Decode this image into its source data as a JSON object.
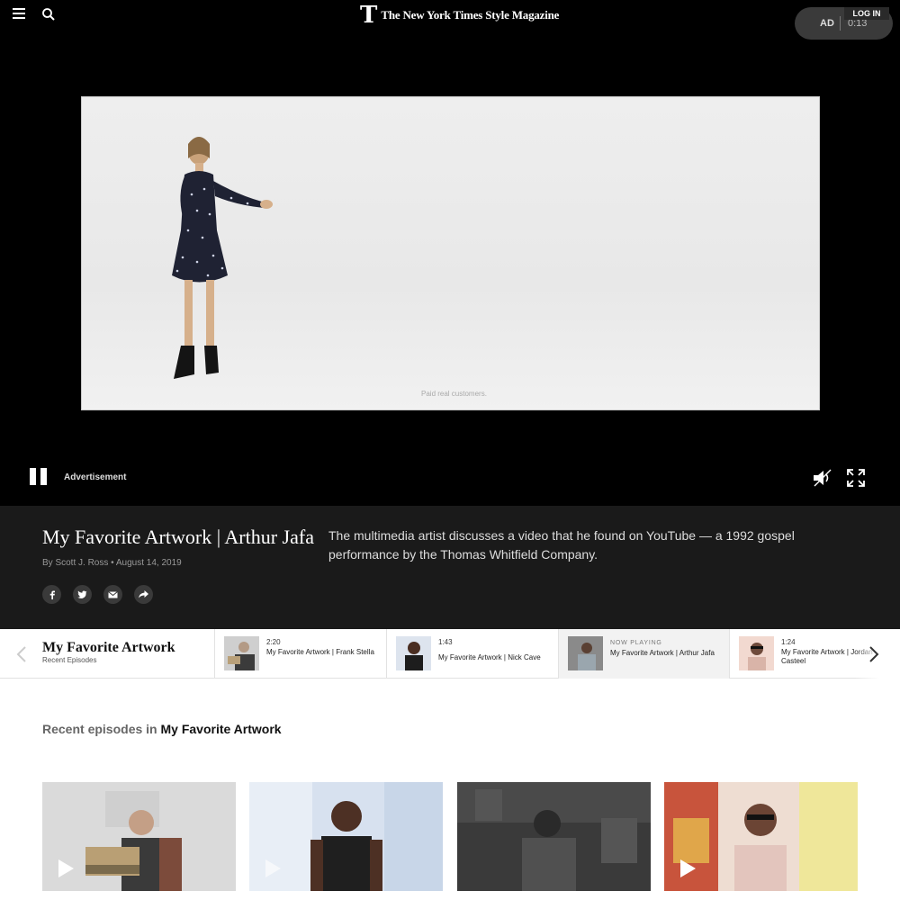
{
  "header": {
    "logo_mark": "T",
    "logo_text": "The New York Times Style Magazine",
    "ad_label": "AD",
    "ad_time": "0:13",
    "login_label": "LOG IN"
  },
  "video": {
    "disclaimer": "Paid real customers.",
    "advertisement_label": "Advertisement"
  },
  "info": {
    "title": "My Favorite Artwork | Arthur Jafa",
    "byline": "By Scott J. Ross • August 14, 2019",
    "description": "The multimedia artist discusses a video that he found on YouTube — a 1992 gospel performance by the Thomas Whitfield Company.",
    "share": [
      "facebook",
      "twitter",
      "email",
      "share"
    ]
  },
  "strip": {
    "series_title": "My Favorite Artwork",
    "series_subtitle": "Recent Episodes",
    "episodes": [
      {
        "duration": "2:20",
        "title": "My Favorite Artwork | Frank Stella",
        "now_playing": false
      },
      {
        "duration": "1:43",
        "title": "My Favorite Artwork | Nick Cave",
        "now_playing": false
      },
      {
        "now_label": "NOW PLAYING",
        "title": "My Favorite Artwork | Arthur Jafa",
        "now_playing": true
      },
      {
        "duration": "1:24",
        "title": "My Favorite Artwork | Jordan Casteel",
        "now_playing": false
      }
    ]
  },
  "recent": {
    "heading_prefix": "Recent episodes in",
    "heading_series": "My Favorite Artwork"
  },
  "colors": {
    "background_dark": "#000000",
    "info_background": "#1a1a1a",
    "page_background": "#ffffff"
  }
}
